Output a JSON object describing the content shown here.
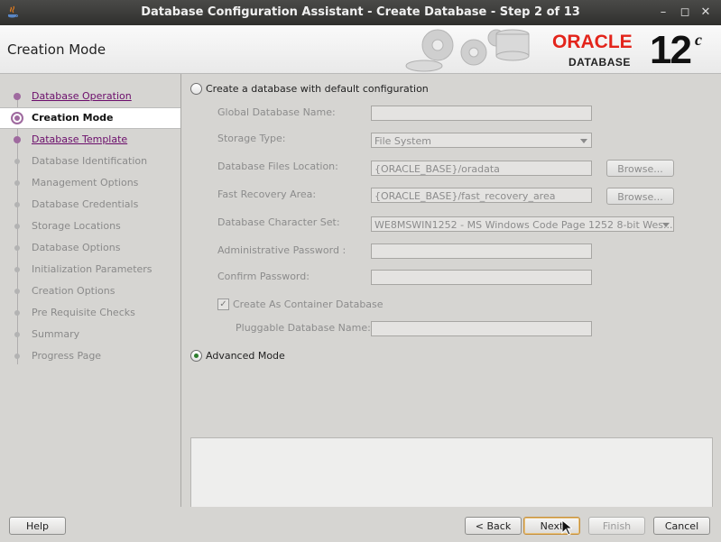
{
  "window": {
    "title": "Database Configuration Assistant - Create Database - Step 2 of 13"
  },
  "header": {
    "page_title": "Creation Mode",
    "logo": {
      "brand": "ORACLE",
      "product": "DATABASE",
      "version": "12",
      "version_suffix": "c"
    }
  },
  "sidebar": {
    "steps": [
      {
        "label": "Database Operation",
        "state": "done"
      },
      {
        "label": "Creation Mode",
        "state": "current"
      },
      {
        "label": "Database Template",
        "state": "done"
      },
      {
        "label": "Database Identification",
        "state": "future"
      },
      {
        "label": "Management Options",
        "state": "future"
      },
      {
        "label": "Database Credentials",
        "state": "future"
      },
      {
        "label": "Storage Locations",
        "state": "future"
      },
      {
        "label": "Database Options",
        "state": "future"
      },
      {
        "label": "Initialization Parameters",
        "state": "future"
      },
      {
        "label": "Creation Options",
        "state": "future"
      },
      {
        "label": "Pre Requisite Checks",
        "state": "future"
      },
      {
        "label": "Summary",
        "state": "future"
      },
      {
        "label": "Progress Page",
        "state": "future"
      }
    ]
  },
  "main": {
    "default_config": {
      "label": "Create a database with default configuration",
      "selected": false
    },
    "fields": {
      "global_db_name": {
        "label": "Global Database Name:",
        "value": ""
      },
      "storage_type": {
        "label": "Storage Type:",
        "value": "File System"
      },
      "db_files_location": {
        "label": "Database Files Location:",
        "value": "{ORACLE_BASE}/oradata"
      },
      "fast_recovery_area": {
        "label": "Fast Recovery Area:",
        "value": "{ORACLE_BASE}/fast_recovery_area"
      },
      "charset": {
        "label": "Database Character Set:",
        "value": "WE8MSWIN1252 - MS Windows Code Page 1252 8-bit Wes..."
      },
      "admin_password": {
        "label": "Administrative Password :",
        "value": ""
      },
      "confirm_password": {
        "label": "Confirm Password:",
        "value": ""
      },
      "pluggable_db_name": {
        "label": "Pluggable Database Name:",
        "value": ""
      }
    },
    "browse_label": "Browse...",
    "container_db": {
      "label": "Create As Container Database",
      "checked": true
    },
    "advanced_mode": {
      "label": "Advanced Mode",
      "selected": true
    }
  },
  "footer": {
    "help": "Help",
    "back": "< Back",
    "next": "Next",
    "finish": "Finish",
    "cancel": "Cancel"
  },
  "colors": {
    "oracle_red": "#e3241b",
    "completed_step": "#6b0d6b",
    "radio_selected": "#2d7d2d"
  }
}
